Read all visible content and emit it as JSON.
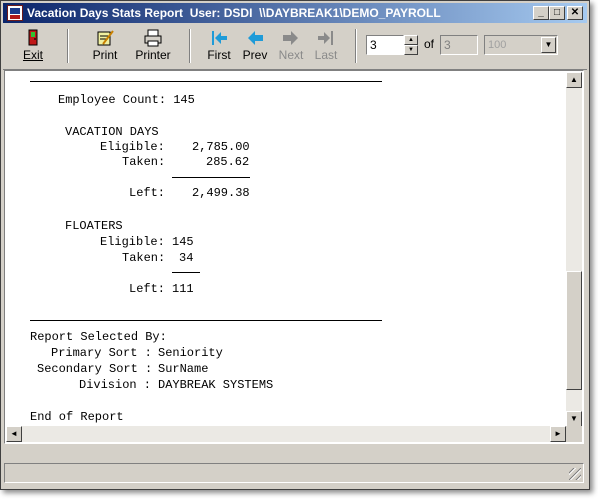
{
  "window": {
    "title": "Vacation Days Stats Report  User: DSDI  \\\\DAYBREAK1\\DEMO_PAYROLL",
    "minimize_glyph": "_",
    "maximize_glyph": "□",
    "close_glyph": "✕"
  },
  "toolbar": {
    "exit": {
      "label": "Exit",
      "icon": "exit-door-icon"
    },
    "print": {
      "label": "Print",
      "icon": "print-pencil-icon"
    },
    "printer": {
      "label": "Printer",
      "icon": "printer-icon"
    },
    "first": {
      "label": "First",
      "icon": "first-page-arrow-icon"
    },
    "prev": {
      "label": "Prev",
      "icon": "prev-arrow-icon"
    },
    "next": {
      "label": "Next",
      "icon": "next-arrow-icon"
    },
    "last": {
      "label": "Last",
      "icon": "last-page-arrow-icon"
    },
    "page_value": "3",
    "of_label": "of",
    "total_pages": "3",
    "zoom_value": "100",
    "colors": {
      "nav_active": "#1f9bd8",
      "nav_disabled": "#8a8a8a"
    }
  },
  "report": {
    "employee_count_label": "Employee Count:",
    "employee_count": "145",
    "vacation_days_heading": "VACATION DAYS",
    "vac_eligible_label": "Eligible:",
    "vac_eligible": "2,785.00",
    "vac_taken_label": "Taken:",
    "vac_taken": "285.62",
    "vac_left_label": "Left:",
    "vac_left": "2,499.38",
    "floaters_heading": "FLOATERS",
    "flt_eligible_label": "Eligible:",
    "flt_eligible": "145",
    "flt_taken_label": "Taken:",
    "flt_taken": "34",
    "flt_left_label": "Left:",
    "flt_left": "111",
    "selected_by_label": "Report Selected By:",
    "primary_sort_label": "Primary Sort :",
    "primary_sort": "Seniority",
    "secondary_sort_label": "Secondary Sort :",
    "secondary_sort": "SurName",
    "division_label": "Division :",
    "division": "DAYBREAK SYSTEMS",
    "end_label": "End of Report"
  },
  "scrollbar": {
    "up_glyph": "▲",
    "down_glyph": "▼",
    "left_glyph": "◄",
    "right_glyph": "►"
  }
}
